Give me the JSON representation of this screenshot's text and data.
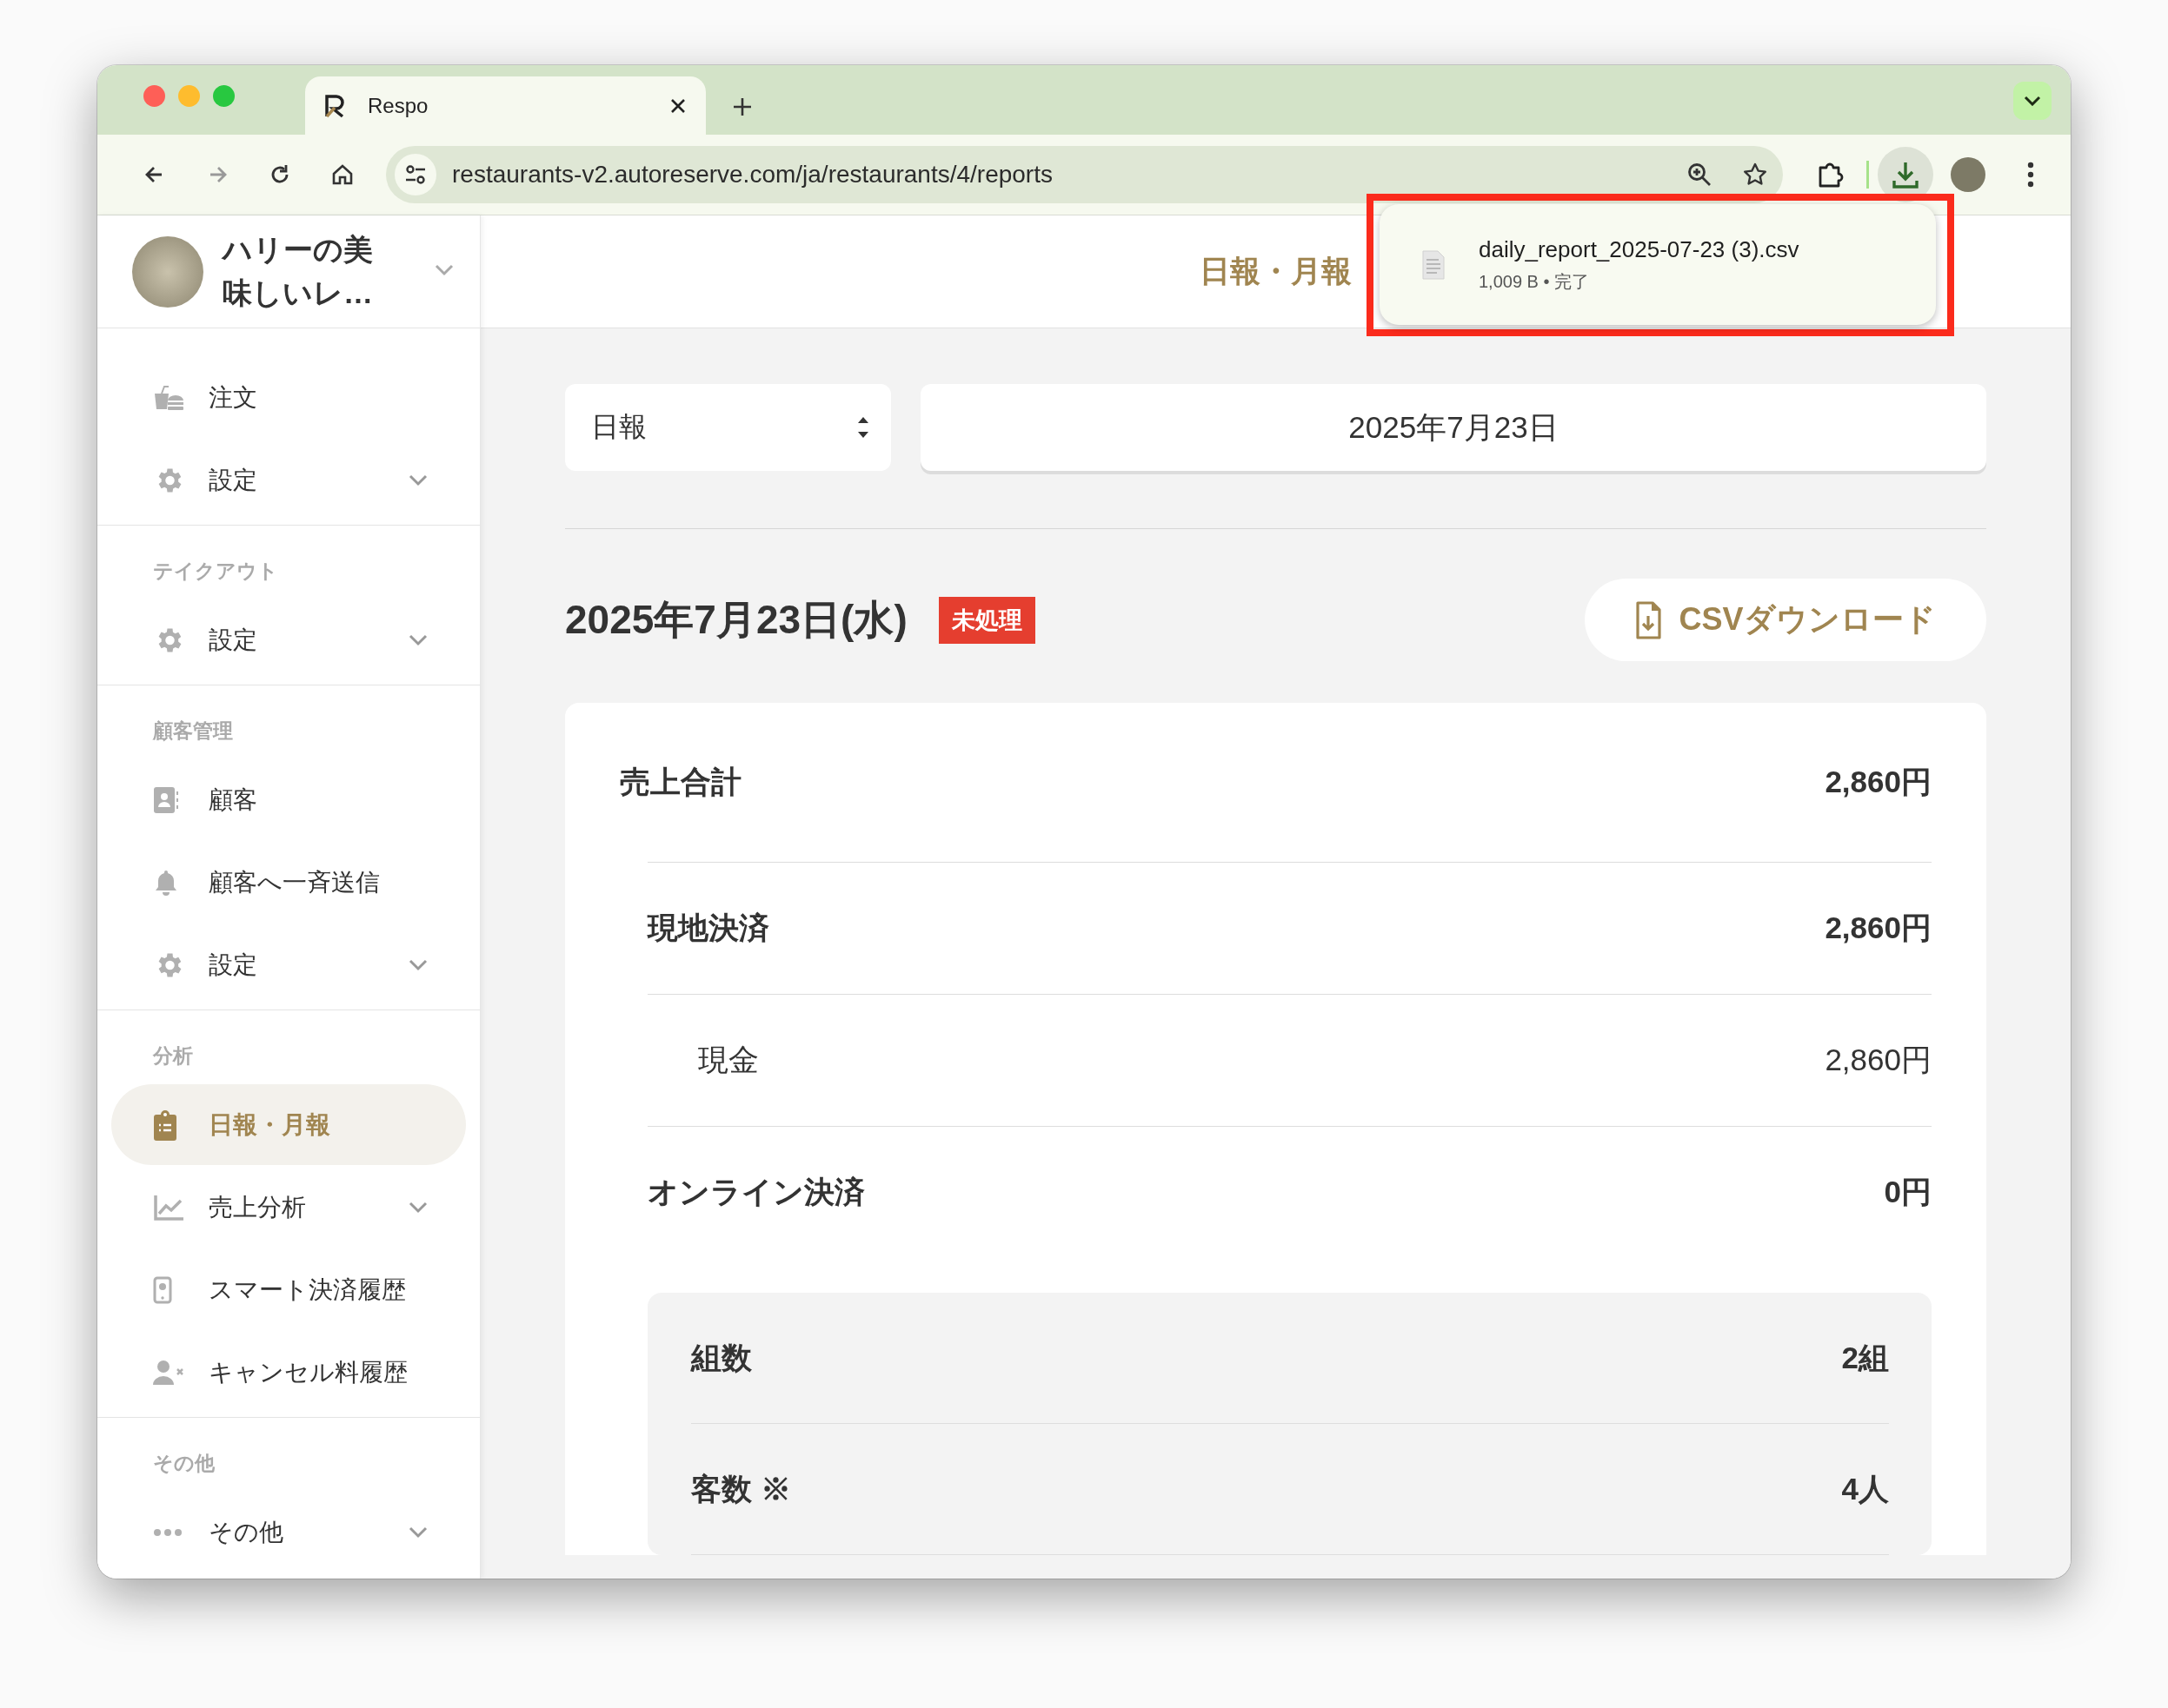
{
  "browser": {
    "tab": {
      "title": "Respo"
    },
    "url": "restaurants-v2.autoreserve.com/ja/restaurants/4/reports",
    "download": {
      "filename": "daily_report_2025-07-23 (3).csv",
      "meta": "1,009 B • 完了"
    }
  },
  "sidebar": {
    "restaurant": "ハリーの美味しいレ…",
    "groups": [
      {
        "items": [
          {
            "label": "注文",
            "expandable": false,
            "selected": false
          },
          {
            "label": "設定",
            "expandable": true,
            "selected": false
          }
        ]
      },
      {
        "label": "テイクアウト",
        "items": [
          {
            "label": "設定",
            "expandable": true,
            "selected": false
          }
        ]
      },
      {
        "label": "顧客管理",
        "items": [
          {
            "label": "顧客",
            "expandable": false,
            "selected": false
          },
          {
            "label": "顧客へ一斉送信",
            "expandable": false,
            "selected": false
          },
          {
            "label": "設定",
            "expandable": true,
            "selected": false
          }
        ]
      },
      {
        "label": "分析",
        "items": [
          {
            "label": "日報・月報",
            "expandable": false,
            "selected": true
          },
          {
            "label": "売上分析",
            "expandable": true,
            "selected": false
          },
          {
            "label": "スマート決済履歴",
            "expandable": false,
            "selected": false
          },
          {
            "label": "キャンセル料履歴",
            "expandable": false,
            "selected": false
          }
        ]
      },
      {
        "label": "その他",
        "items": [
          {
            "label": "その他",
            "expandable": true,
            "selected": false
          }
        ]
      }
    ]
  },
  "header": {
    "title": "日報・月報"
  },
  "report": {
    "period": "日報",
    "date": "2025年7月23日",
    "heading": "2025年7月23日(水)",
    "status": "未処理",
    "csv_button": "CSVダウンロード",
    "rows": [
      {
        "kind": "total",
        "label": "売上合計",
        "value": "2,860円"
      },
      {
        "kind": "method",
        "label": "現地決済",
        "value": "2,860円"
      },
      {
        "kind": "detail",
        "label": "現金",
        "value": "2,860円"
      },
      {
        "kind": "method",
        "label": "オンライン決済",
        "value": "0円"
      }
    ],
    "stats": [
      {
        "label": "組数",
        "value": "2組"
      },
      {
        "label": "客数 ※",
        "value": "4人"
      }
    ]
  }
}
